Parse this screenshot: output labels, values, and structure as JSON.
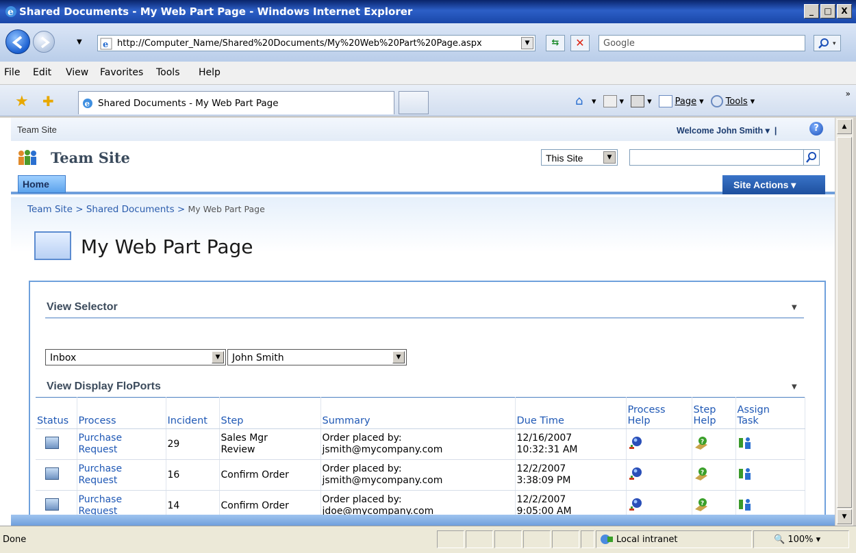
{
  "window": {
    "title": "Shared Documents - My Web Part Page - Windows Internet Explorer",
    "buttons": [
      "_",
      "□",
      "X"
    ]
  },
  "address": {
    "url": "http://Computer_Name/Shared%20Documents/My%20Web%20Part%20Page.aspx",
    "search_placeholder": "Google"
  },
  "menu": [
    "File",
    "Edit",
    "View",
    "Favorites",
    "Tools",
    "Help"
  ],
  "tab": {
    "label": "Shared Documents - My Web Part Page"
  },
  "commandbar": {
    "page": "Page",
    "tools": "Tools"
  },
  "site": {
    "crumb": "Team Site",
    "welcome": "Welcome John Smith",
    "title": "Team Site",
    "scope": "This Site",
    "home_tab": "Home",
    "site_actions": "Site Actions"
  },
  "breadcrumb": {
    "item1": "Team Site",
    "sep": " > ",
    "item2": "Shared Documents",
    "current": "My Web Part Page"
  },
  "page_title": "My Web Part Page",
  "view_selector": {
    "title": "View Selector",
    "list_value": "Inbox",
    "user_value": "John Smith"
  },
  "floports": {
    "title": "View Display FloPorts",
    "headers": {
      "status": "Status",
      "process": "Process",
      "incident": "Incident",
      "step": "Step",
      "summary": "Summary",
      "due": "Due Time",
      "process_help_1": "Process",
      "process_help_2": "Help",
      "step_help_1": "Step",
      "step_help_2": "Help",
      "assign_1": "Assign",
      "assign_2": "Task"
    },
    "rows": [
      {
        "process_1": "Purchase",
        "process_2": "Request",
        "incident": "29",
        "step_1": "Sales Mgr",
        "step_2": "Review",
        "summary_1": "Order placed by:",
        "summary_2": "jsmith@mycompany.com",
        "due_1": "12/16/2007",
        "due_2": "10:32:31 AM"
      },
      {
        "process_1": "Purchase",
        "process_2": "Request",
        "incident": "16",
        "step_1": "Confirm Order",
        "step_2": "",
        "summary_1": "Order placed by:",
        "summary_2": "jsmith@mycompany.com",
        "due_1": "12/2/2007",
        "due_2": "3:38:09 PM"
      },
      {
        "process_1": "Purchase",
        "process_2": "Request",
        "incident": "14",
        "step_1": "Confirm Order",
        "step_2": "",
        "summary_1": "Order placed by:",
        "summary_2": "jdoe@mycompany.com",
        "due_1": "12/2/2007",
        "due_2": "9:05:00 AM"
      }
    ]
  },
  "status": {
    "text": "Done",
    "zone": "Local intranet",
    "zoom": "100%"
  }
}
